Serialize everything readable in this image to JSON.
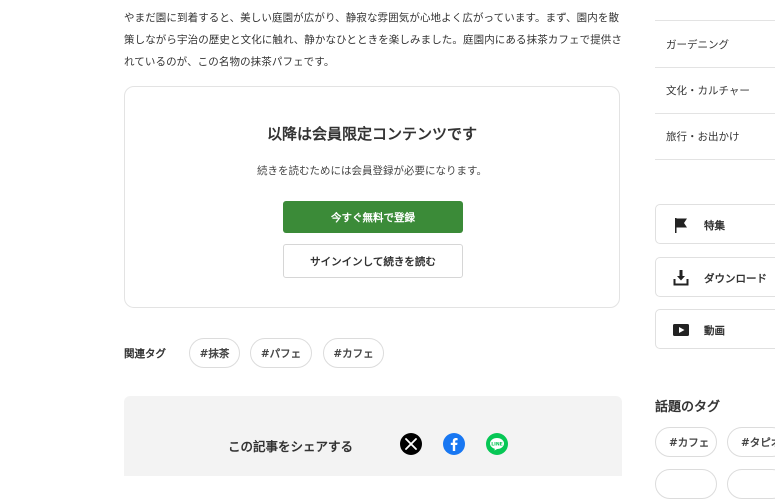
{
  "article": {
    "intro": "やまだ園に到着すると、美しい庭園が広がり、静寂な雰囲気が心地よく広がっています。まず、園内を散策しながら宇治の歴史と文化に触れ、静かなひとときを楽しみました。庭園内にある抹茶カフェで提供されているのが、この名物の抹茶パフェです。"
  },
  "members": {
    "title": "以降は会員限定コンテンツです",
    "description": "続きを読むためには会員登録が必要になります。",
    "register_button": "今すぐ無料で登録",
    "signin_button": "サインインして続きを読む"
  },
  "tags": {
    "label": "関連タグ",
    "items": [
      "#抹茶",
      "#パフェ",
      "#カフェ"
    ]
  },
  "share": {
    "label": "この記事をシェアする",
    "icons": [
      "x-icon",
      "facebook-icon",
      "line-icon"
    ],
    "colors": {
      "x": "#000000",
      "facebook": "#1877f2",
      "line": "#06c755"
    }
  },
  "sidebar": {
    "categories": [
      "ガーデニング",
      "文化・カルチャー",
      "旅行・お出かけ"
    ],
    "cards": [
      {
        "icon": "flag-icon",
        "label": "特集"
      },
      {
        "icon": "download-icon",
        "label": "ダウンロード"
      },
      {
        "icon": "video-icon",
        "label": "動画"
      }
    ],
    "topic_title": "話題のタグ",
    "topic_tags": [
      "#カフェ",
      "#タピオ"
    ]
  },
  "colors": {
    "accent": "#3b8b38",
    "border": "#e3e3e3",
    "share_bg": "#f3f3f3"
  }
}
